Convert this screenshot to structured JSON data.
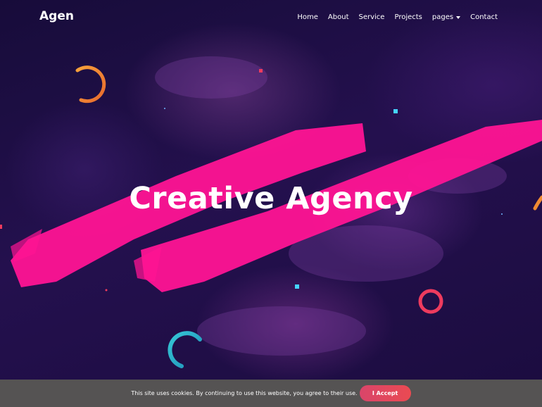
{
  "brand": "Agen",
  "nav": {
    "items": [
      {
        "label": "Home"
      },
      {
        "label": "About"
      },
      {
        "label": "Service"
      },
      {
        "label": "Projects"
      },
      {
        "label": "pages"
      },
      {
        "label": "Contact"
      }
    ]
  },
  "hero": {
    "title": "Creative Agency"
  },
  "cookie": {
    "text": "This site uses cookies. By continuing to use this website, you agree to their use.",
    "button_label": "I Accept"
  },
  "colors": {
    "background": "#1a0f3d",
    "brush": "#ff1493",
    "orange_ring": "#f08a32",
    "cyan_ring": "#2fb8c9",
    "red_ring": "#ee3b5e",
    "cookie_bar": "#555353",
    "button": "#e3475f"
  }
}
